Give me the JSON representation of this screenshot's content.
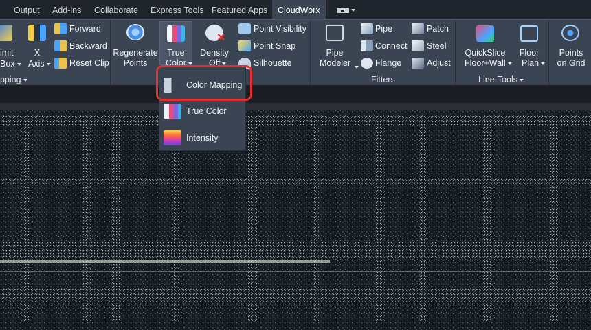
{
  "tabs": [
    "Output",
    "Add-ins",
    "Collaborate",
    "Express Tools",
    "Featured Apps",
    "CloudWorx"
  ],
  "ribbon": {
    "limit_box": [
      "imit",
      "Box"
    ],
    "x_axis": [
      "X",
      "Axis"
    ],
    "clip_items": [
      "Forward",
      "Backward",
      "Reset Clip"
    ],
    "regenerate": [
      "Regenerate",
      "Points"
    ],
    "true_color": [
      "True",
      "Color"
    ],
    "density": [
      "Density",
      "Off"
    ],
    "point_items": [
      "Point Visibility",
      "Point Snap",
      "Silhouette"
    ],
    "pipe_modeler": [
      "Pipe",
      "Modeler"
    ],
    "fit_items": [
      "Pipe",
      "Connect",
      "Flange"
    ],
    "fit_items2": [
      "Patch",
      "Steel",
      "Adjust"
    ],
    "quickslice": [
      "QuickSlice",
      "Floor+Wall"
    ],
    "floor_plan": [
      "Floor",
      "Plan"
    ],
    "points_grid": [
      "Points",
      "on Grid"
    ],
    "group_clipping": "pping",
    "group_fitters": "Fitters",
    "group_linetools": "Line-Tools"
  },
  "menu": {
    "items": [
      "Color Mapping",
      "True Color",
      "Intensity"
    ]
  },
  "colors": {
    "ribbon": "#3b4453",
    "tab_bar": "#20242c",
    "highlight": "#e4302b",
    "viewport": "#141a20"
  }
}
